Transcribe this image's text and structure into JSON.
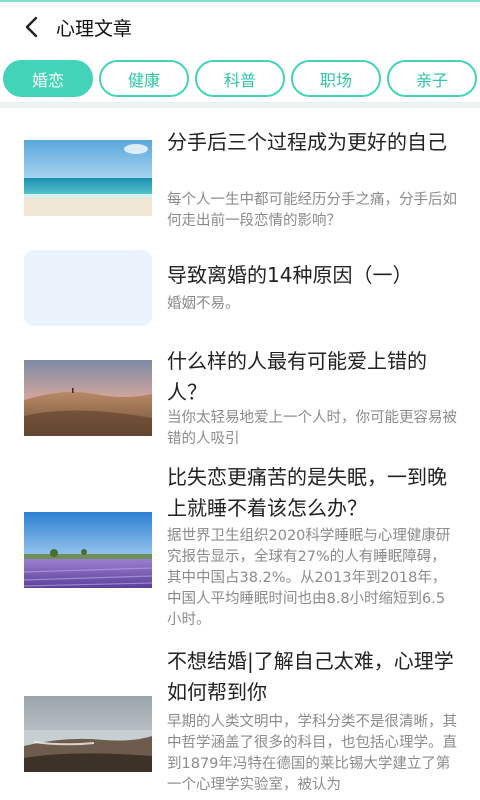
{
  "header": {
    "title": "心理文章",
    "back_icon": "chevron-left-icon"
  },
  "tabs": [
    {
      "label": "婚恋",
      "active": true
    },
    {
      "label": "健康",
      "active": false
    },
    {
      "label": "科普",
      "active": false
    },
    {
      "label": "职场",
      "active": false
    },
    {
      "label": "亲子",
      "active": false
    }
  ],
  "colors": {
    "accent": "#43d3b9",
    "text_primary": "#222222",
    "text_secondary": "#8b8b8b"
  },
  "articles": [
    {
      "title": "分手后三个过程成为更好的自己",
      "desc": "每个人一生中都可能经历分手之痛，分手后如何走出前一段恋情的影响？",
      "image": "beach-ocean"
    },
    {
      "title": "导致离婚的14种原因（一）",
      "desc": "婚姻不易。",
      "image": "placeholder"
    },
    {
      "title": "什么样的人最有可能爱上错的人？",
      "desc": "当你太轻易地爱上一个人时，你可能更容易被错的人吸引",
      "image": "desert-dunes"
    },
    {
      "title": "比失恋更痛苦的是失眠，一到晚上就睡不着该怎么办？",
      "desc": "据世界卫生组织2020科学睡眠与心理健康研究报告显示，全球有27%的人有睡眠障碍，其中中国占38.2%。从2013年到2018年，中国人平均睡眠时间也由8.8小时缩短到6.5小时。",
      "image": "lavender-field"
    },
    {
      "title": "不想结婚|了解自己太难，心理学如何帮到你",
      "desc": "早期的人类文明中，学科分类不是很清晰，其中哲学涵盖了很多的科目，也包括心理学。直到1879年冯特在德国的莱比锡大学建立了第一个心理学实验室，被认为",
      "image": "rocky-coast"
    }
  ]
}
